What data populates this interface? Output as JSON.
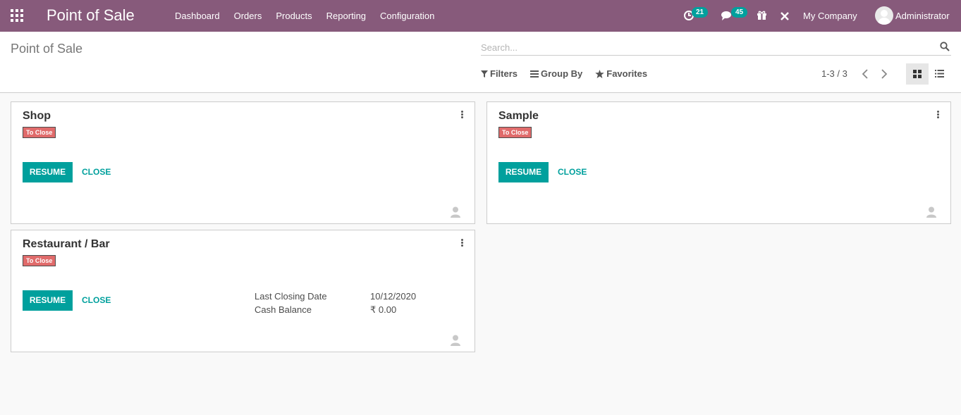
{
  "navbar": {
    "brand": "Point of Sale",
    "menu": [
      "Dashboard",
      "Orders",
      "Products",
      "Reporting",
      "Configuration"
    ],
    "activity_count": "21",
    "message_count": "45",
    "company": "My Company",
    "user": "Administrator"
  },
  "control": {
    "breadcrumb": "Point of Sale",
    "search_placeholder": "Search...",
    "filters_label": "Filters",
    "groupby_label": "Group By",
    "favorites_label": "Favorites",
    "pager": "1-3 / 3"
  },
  "cards": [
    {
      "name": "Shop",
      "status": "To Close",
      "resume": "RESUME",
      "close": "CLOSE"
    },
    {
      "name": "Sample",
      "status": "To Close",
      "resume": "RESUME",
      "close": "CLOSE"
    },
    {
      "name": "Restaurant / Bar",
      "status": "To Close",
      "resume": "RESUME",
      "close": "CLOSE",
      "last_closing_label": "Last Closing Date",
      "last_closing_value": "10/12/2020",
      "cash_balance_label": "Cash Balance",
      "cash_balance_value": "₹ 0.00"
    }
  ],
  "colors": {
    "navbar": "#875a7b",
    "primary": "#00a09d",
    "tag": "#e06b6b"
  }
}
